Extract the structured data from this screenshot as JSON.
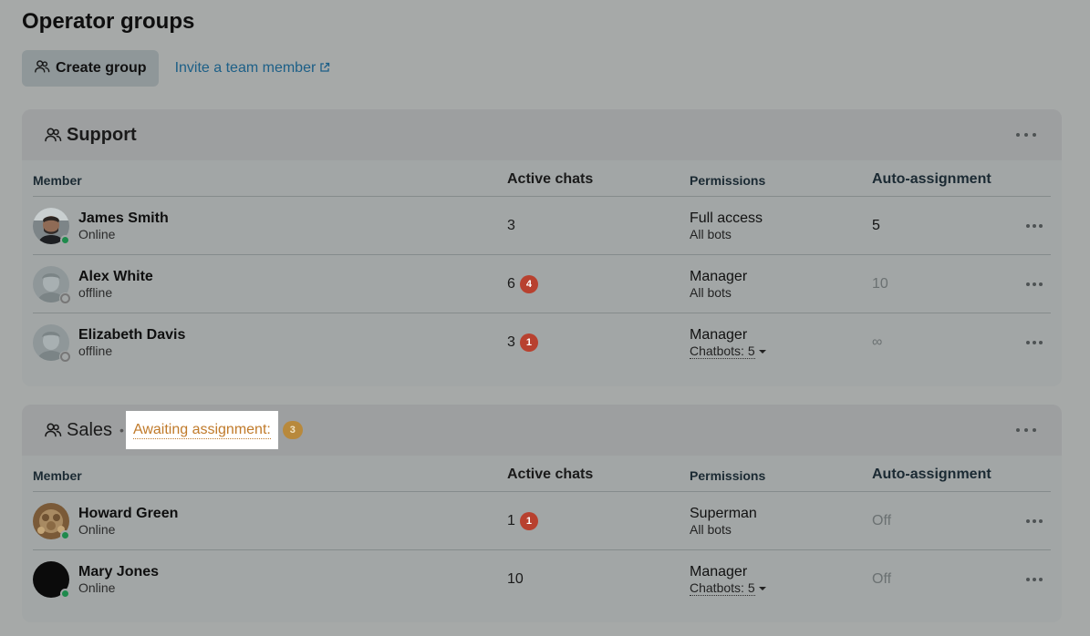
{
  "page": {
    "title": "Operator groups",
    "create_label": "Create group",
    "invite_label": "Invite a team member"
  },
  "columns": {
    "member": "Member",
    "active": "Active chats",
    "permissions": "Permissions",
    "auto": "Auto-assignment"
  },
  "groups": [
    {
      "name": "Support",
      "members": [
        {
          "name": "James Smith",
          "status": "Online",
          "active": "3",
          "badge": "",
          "role": "Full access",
          "scope": "All bots",
          "auto": "5"
        },
        {
          "name": "Alex White",
          "status": "offline",
          "active": "6",
          "badge": "4",
          "role": "Manager",
          "scope": "All bots",
          "auto": "10"
        },
        {
          "name": "Elizabeth Davis",
          "status": "offline",
          "active": "3",
          "badge": "1",
          "role": "Manager",
          "scope": "Chatbots: 5",
          "auto": "∞"
        }
      ]
    },
    {
      "name": "Sales",
      "awaiting_label": "Awaiting assignment:",
      "awaiting_count": "3",
      "members": [
        {
          "name": "Howard Green",
          "status": "Online",
          "active": "1",
          "badge": "1",
          "role": "Superman",
          "scope": "All bots",
          "auto": "Off"
        },
        {
          "name": "Mary Jones",
          "status": "Online",
          "active": "10",
          "badge": "",
          "role": "Manager",
          "scope": "Chatbots: 5",
          "auto": "Off"
        }
      ]
    }
  ],
  "colors": {
    "online": "#1e8a4c",
    "badge_red": "#b8412f",
    "awaiting": "#c07a2a",
    "link": "#1c5f87"
  }
}
